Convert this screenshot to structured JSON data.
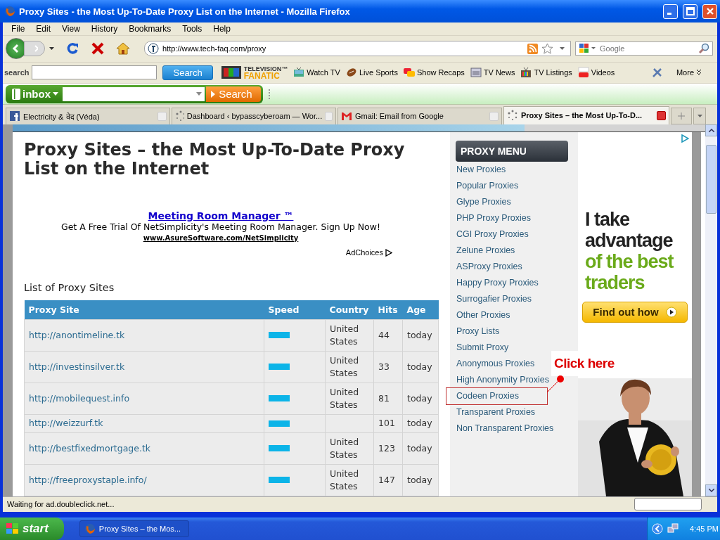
{
  "window": {
    "title": "Proxy Sites - the Most Up-To-Date Proxy List on the Internet - Mozilla Firefox"
  },
  "menu_bar": [
    "File",
    "Edit",
    "View",
    "History",
    "Bookmarks",
    "Tools",
    "Help"
  ],
  "nav_toolbar": {
    "url": "http://www.tech-faq.com/proxy",
    "search_placeholder": "Google"
  },
  "tv_toolbar": {
    "label": "search",
    "button": "Search",
    "logo_top": "TELEVISION™",
    "logo_bottom": "FANATIC",
    "items": [
      "Watch TV",
      "Live Sports",
      "Show Recaps",
      "TV News",
      "TV Listings",
      "Videos"
    ],
    "more": "More"
  },
  "inbox_toolbar": {
    "logo": "inbox",
    "button": "Search"
  },
  "tabs": [
    {
      "label": "Electricity & वेद (Véda)",
      "selected": false
    },
    {
      "label": "Dashboard ‹ bypasscyberoam — Wor...",
      "selected": false
    },
    {
      "label": "Gmail: Email from Google",
      "selected": false
    },
    {
      "label": "Proxy Sites – the Most Up-To-D...",
      "selected": true
    }
  ],
  "page": {
    "heading": "Proxy Sites – the Most Up-To-Date Proxy List on the Internet",
    "ad": {
      "title": "Meeting Room Manager ™",
      "text": "Get A Free Trial Of NetSimplicity's Meeting Room Manager. Sign Up Now!",
      "url": "www.AsureSoftware.com/NetSimplicity",
      "choices": "AdChoices"
    },
    "list_title": "List of Proxy Sites",
    "table": {
      "columns": [
        "Proxy Site",
        "Speed",
        "Country",
        "Hits",
        "Age"
      ],
      "rows": [
        {
          "site": "http://anontimeline.tk",
          "country": "United States",
          "hits": "44",
          "age": "today"
        },
        {
          "site": "http://investinsilver.tk",
          "country": "United States",
          "hits": "33",
          "age": "today"
        },
        {
          "site": "http://mobilequest.info",
          "country": "United States",
          "hits": "81",
          "age": "today"
        },
        {
          "site": "http://weizzurf.tk",
          "hits": "101",
          "age": "today"
        },
        {
          "site": "http://bestfixedmortgage.tk",
          "country": "United States",
          "hits": "123",
          "age": "today"
        },
        {
          "site": "http://freeproxystaple.info/",
          "country": "United States",
          "hits": "147",
          "age": "today"
        }
      ]
    }
  },
  "sidebar": {
    "title": "PROXY MENU",
    "items": [
      {
        "label": "New Proxies",
        "highlighted": false
      },
      {
        "label": "Popular Proxies",
        "highlighted": false
      },
      {
        "label": "Glype Proxies",
        "highlighted": false
      },
      {
        "label": "PHP Proxy Proxies",
        "highlighted": false
      },
      {
        "label": "CGI Proxy Proxies",
        "highlighted": false
      },
      {
        "label": "Zelune Proxies",
        "highlighted": false
      },
      {
        "label": "ASProxy Proxies",
        "highlighted": false
      },
      {
        "label": "Happy Proxy Proxies",
        "highlighted": false
      },
      {
        "label": "Surrogafier Proxies",
        "highlighted": false
      },
      {
        "label": "Other Proxies",
        "highlighted": false
      },
      {
        "label": "Proxy Lists",
        "highlighted": false
      },
      {
        "label": "Submit Proxy",
        "highlighted": false
      },
      {
        "label": "Anonymous Proxies",
        "highlighted": false
      },
      {
        "label": "High Anonymity Proxies",
        "highlighted": false
      },
      {
        "label": "Codeen Proxies",
        "highlighted": true
      },
      {
        "label": "Transparent Proxies",
        "highlighted": false
      },
      {
        "label": "Non Transparent Proxies",
        "highlighted": false
      }
    ]
  },
  "banner_ad": {
    "lines": [
      {
        "text": "I take",
        "accent": false
      },
      {
        "text": "advantage",
        "accent": false
      },
      {
        "text": "of the best",
        "accent": true
      },
      {
        "text": "traders",
        "accent": true
      }
    ],
    "button": "Find out how"
  },
  "annotation": {
    "text": "Click here"
  },
  "status_bar": {
    "text": "Waiting for ad.doubleclick.net..."
  },
  "taskbar": {
    "start": "start",
    "task": "Proxy Sites – the Mos...",
    "clock": "4:45 PM"
  }
}
